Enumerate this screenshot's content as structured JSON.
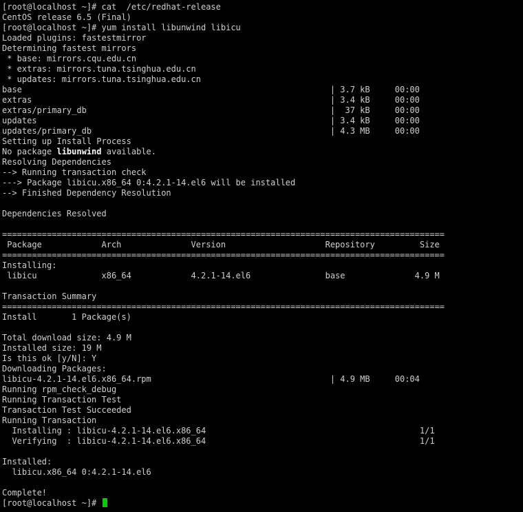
{
  "colors": {
    "background": "#000000",
    "foreground": "#cfcfcf",
    "bold": "#ffffff",
    "cursor": "#00d000"
  },
  "terminal": {
    "lines": [
      [
        {
          "t": "[root@localhost ~]# cat  /etc/redhat-release"
        }
      ],
      [
        {
          "t": "CentOS release 6.5 (Final)"
        }
      ],
      [
        {
          "t": "[root@localhost ~]# yum install libunwind libicu"
        }
      ],
      [
        {
          "t": "Loaded plugins: fastestmirror"
        }
      ],
      [
        {
          "t": "Determining fastest mirrors"
        }
      ],
      [
        {
          "t": " * base: mirrors.cqu.edu.cn"
        }
      ],
      [
        {
          "t": " * extras: mirrors.tuna.tsinghua.edu.cn"
        }
      ],
      [
        {
          "t": " * updates: mirrors.tuna.tsinghua.edu.cn"
        }
      ],
      [
        {
          "t": "base                                                              | 3.7 kB     00:00"
        }
      ],
      [
        {
          "t": "extras                                                            | 3.4 kB     00:00"
        }
      ],
      [
        {
          "t": "extras/primary_db                                                 |  37 kB     00:00"
        }
      ],
      [
        {
          "t": "updates                                                           | 3.4 kB     00:00"
        }
      ],
      [
        {
          "t": "updates/primary_db                                                | 4.3 MB     00:00"
        }
      ],
      [
        {
          "t": "Setting up Install Process"
        }
      ],
      [
        {
          "t": "No package "
        },
        {
          "t": "libunwind",
          "b": true
        },
        {
          "t": " available."
        }
      ],
      [
        {
          "t": "Resolving Dependencies"
        }
      ],
      [
        {
          "t": "--> Running transaction check"
        }
      ],
      [
        {
          "t": "---> Package libicu.x86_64 0:4.2.1-14.el6 will be installed"
        }
      ],
      [
        {
          "t": "--> Finished Dependency Resolution"
        }
      ],
      [
        {
          "t": ""
        }
      ],
      [
        {
          "t": "Dependencies Resolved"
        }
      ],
      [
        {
          "t": ""
        }
      ],
      [
        {
          "t": "========================================================================================="
        }
      ],
      [
        {
          "t": " Package            Arch              Version                    Repository         Size"
        }
      ],
      [
        {
          "t": "========================================================================================="
        }
      ],
      [
        {
          "t": "Installing:"
        }
      ],
      [
        {
          "t": " libicu             x86_64            4.2.1-14.el6               base              4.9 M"
        }
      ],
      [
        {
          "t": ""
        }
      ],
      [
        {
          "t": "Transaction Summary"
        }
      ],
      [
        {
          "t": "========================================================================================="
        }
      ],
      [
        {
          "t": "Install       1 Package(s)"
        }
      ],
      [
        {
          "t": ""
        }
      ],
      [
        {
          "t": "Total download size: 4.9 M"
        }
      ],
      [
        {
          "t": "Installed size: 19 M"
        }
      ],
      [
        {
          "t": "Is this ok [y/N]: Y"
        }
      ],
      [
        {
          "t": "Downloading Packages:"
        }
      ],
      [
        {
          "t": "libicu-4.2.1-14.el6.x86_64.rpm                                    | 4.9 MB     00:04"
        }
      ],
      [
        {
          "t": "Running rpm_check_debug"
        }
      ],
      [
        {
          "t": "Running Transaction Test"
        }
      ],
      [
        {
          "t": "Transaction Test Succeeded"
        }
      ],
      [
        {
          "t": "Running Transaction"
        }
      ],
      [
        {
          "t": "  Installing : libicu-4.2.1-14.el6.x86_64                                           1/1"
        }
      ],
      [
        {
          "t": "  Verifying  : libicu-4.2.1-14.el6.x86_64                                           1/1"
        }
      ],
      [
        {
          "t": ""
        }
      ],
      [
        {
          "t": "Installed:"
        }
      ],
      [
        {
          "t": "  libicu.x86_64 0:4.2.1-14.el6"
        }
      ],
      [
        {
          "t": ""
        }
      ],
      [
        {
          "t": "Complete!"
        }
      ],
      [
        {
          "t": "[root@localhost ~]# "
        },
        {
          "cursor": true
        }
      ]
    ]
  }
}
